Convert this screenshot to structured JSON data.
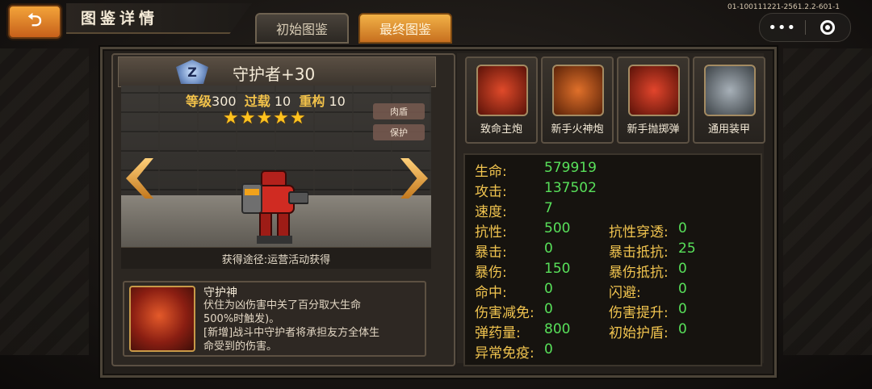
{
  "topbar": {
    "back_label": "⮌",
    "title": "图鉴详情",
    "tabs": [
      "初始图鉴",
      "最终图鉴"
    ],
    "build_id": "01-100111221-2561.2.2-601-1",
    "more_label": "•••"
  },
  "hero": {
    "rank_badge": "Z",
    "name": "守护者+30",
    "level_label": "等级",
    "level_value": "300",
    "overload_label": "过载",
    "overload_value": "10",
    "rebuild_label": "重构",
    "rebuild_value": "10",
    "stars": "★★★★★",
    "star_count": 5,
    "tags": [
      "肉盾",
      "保护"
    ],
    "source": "获得途径:运营活动获得"
  },
  "skill": {
    "name": "守护神",
    "desc_lines": [
      "伏住为凶伤害中关了百分取大生命",
      "500%时触发)。",
      "[新增]战斗中守护者将承担友方全体生",
      "命受到的伤害。"
    ]
  },
  "equipment": [
    {
      "label": "致命主炮",
      "icon": "cannon-shell-icon",
      "color": "#c0392b"
    },
    {
      "label": "新手火神炮",
      "icon": "gatling-gun-icon",
      "color": "#d35400"
    },
    {
      "label": "新手抛掷弹",
      "icon": "grenade-launcher-icon",
      "color": "#c0392b"
    },
    {
      "label": "通用装甲",
      "icon": "armor-plate-icon",
      "color": "#7f8c8d"
    }
  ],
  "attributes": [
    {
      "label": "生命:",
      "value": "579919"
    },
    {
      "label": "攻击:",
      "value": "137502"
    },
    {
      "label": "速度:",
      "value": "7"
    },
    {
      "label": "抗性:",
      "value": "500"
    },
    {
      "label": "抗性穿透:",
      "value": "0"
    },
    {
      "label": "暴击:",
      "value": "0"
    },
    {
      "label": "暴击抵抗:",
      "value": "25"
    },
    {
      "label": "暴伤:",
      "value": "150"
    },
    {
      "label": "暴伤抵抗:",
      "value": "0"
    },
    {
      "label": "命中:",
      "value": "0"
    },
    {
      "label": "闪避:",
      "value": "0"
    },
    {
      "label": "伤害减免:",
      "value": "0"
    },
    {
      "label": "伤害提升:",
      "value": "0"
    },
    {
      "label": "弹药量:",
      "value": "800"
    },
    {
      "label": "初始护盾:",
      "value": "0"
    },
    {
      "label": "异常免疫:",
      "value": "0"
    }
  ],
  "colors": {
    "accent_orange": "#e8891f",
    "attr_label": "#f1c44f",
    "attr_value": "#58e05a",
    "star": "#ffc21e"
  }
}
